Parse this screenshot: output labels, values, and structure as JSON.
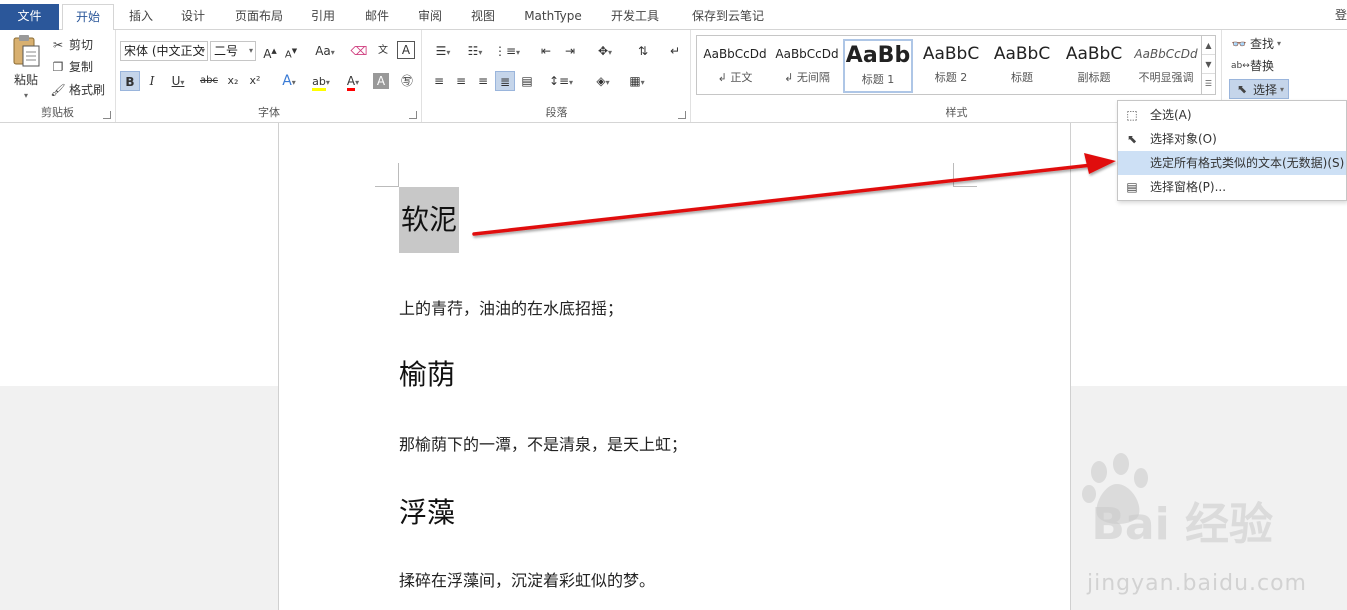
{
  "tabs": {
    "file": "文件",
    "items": [
      "开始",
      "插入",
      "设计",
      "页面布局",
      "引用",
      "邮件",
      "审阅",
      "视图",
      "MathType",
      "开发工具",
      "保存到云笔记"
    ],
    "active_index": 0,
    "login": "登"
  },
  "clipboard": {
    "paste": "粘贴",
    "cut": "剪切",
    "copy": "复制",
    "format_painter": "格式刷",
    "label": "剪贴板"
  },
  "font": {
    "family": "宋体 (中文正文",
    "size": "二号",
    "grow": "A",
    "shrink": "A",
    "change_case": "Aa",
    "bold": "B",
    "italic": "I",
    "underline": "U",
    "strike": "abc",
    "subscript": "x₂",
    "superscript": "x²",
    "label": "字体"
  },
  "paragraph": {
    "label": "段落"
  },
  "styles": {
    "label": "样式",
    "items": [
      {
        "sample": "AaBbCcDd",
        "name": "↲ 正文"
      },
      {
        "sample": "AaBbCcDd",
        "name": "↲ 无间隔"
      },
      {
        "sample": "AaBb",
        "name": "标题 1"
      },
      {
        "sample": "AaBbC",
        "name": "标题 2"
      },
      {
        "sample": "AaBbC",
        "name": "标题"
      },
      {
        "sample": "AaBbC",
        "name": "副标题"
      },
      {
        "sample": "AaBbCcDd",
        "name": "不明显强调"
      }
    ],
    "selected_index": 2
  },
  "editing": {
    "find": "查找",
    "replace": "替换",
    "select": "选择"
  },
  "select_menu": {
    "items": [
      {
        "label": "全选(A)",
        "icon": "select-all-icon"
      },
      {
        "label": "选择对象(O)",
        "icon": "pointer-icon"
      },
      {
        "label": "选定所有格式类似的文本(无数据)(S)",
        "icon": ""
      },
      {
        "label": "选择窗格(P)...",
        "icon": "selection-pane-icon"
      }
    ],
    "hover_index": 2
  },
  "document": {
    "heading1": "软泥",
    "para1": "上的青荇，油油的在水底招摇；",
    "heading2": "榆荫",
    "para2": "那榆荫下的一潭，不是清泉，是天上虹；",
    "heading3": "浮藻",
    "para3": "揉碎在浮藻间，沉淀着彩虹似的梦。"
  },
  "watermark": {
    "brand": "Bai 经验",
    "url": "jingyan.baidu.com"
  },
  "colors": {
    "file_tab": "#2b579a",
    "highlight_bar": "#ffff00",
    "font_color_bar": "#ff0000",
    "arrow": "#e01010"
  }
}
